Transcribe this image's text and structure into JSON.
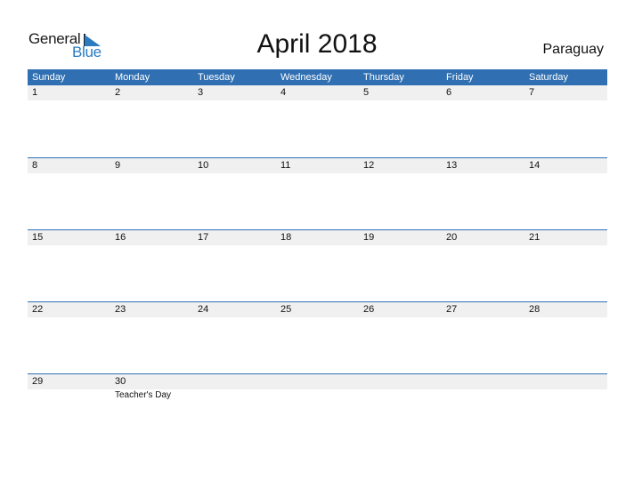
{
  "logo": {
    "general": "General",
    "blue": "Blue"
  },
  "title": "April 2018",
  "country": "Paraguay",
  "colors": {
    "header": "#2f6fb2",
    "band": "#f0f0f0",
    "logo_blue": "#2a7bc0"
  },
  "weekdays": [
    "Sunday",
    "Monday",
    "Tuesday",
    "Wednesday",
    "Thursday",
    "Friday",
    "Saturday"
  ],
  "weeks": [
    {
      "days": [
        "1",
        "2",
        "3",
        "4",
        "5",
        "6",
        "7"
      ]
    },
    {
      "days": [
        "8",
        "9",
        "10",
        "11",
        "12",
        "13",
        "14"
      ]
    },
    {
      "days": [
        "15",
        "16",
        "17",
        "18",
        "19",
        "20",
        "21"
      ]
    },
    {
      "days": [
        "22",
        "23",
        "24",
        "25",
        "26",
        "27",
        "28"
      ]
    },
    {
      "days": [
        "29",
        "30",
        "",
        "",
        "",
        "",
        ""
      ]
    }
  ],
  "events": [
    {
      "week": 4,
      "day_index": 1,
      "label": "Teacher's Day"
    }
  ]
}
